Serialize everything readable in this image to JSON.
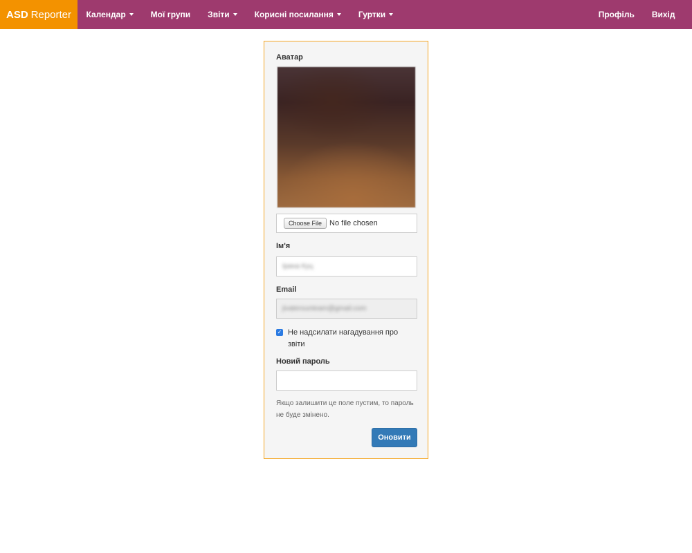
{
  "navbar": {
    "brand_bold": "ASD",
    "brand_regular": "Reporter",
    "left_items": [
      {
        "label": "Календар",
        "dropdown": true
      },
      {
        "label": "Мої групи",
        "dropdown": false
      },
      {
        "label": "Звіти",
        "dropdown": true
      },
      {
        "label": "Корисні посилання",
        "dropdown": true
      },
      {
        "label": "Гуртки",
        "dropdown": true
      }
    ],
    "right_items": [
      {
        "label": "Профіль"
      },
      {
        "label": "Вихід"
      }
    ],
    "colors": {
      "bar": "#9e3a6e",
      "brand": "#f39200"
    }
  },
  "form": {
    "avatar_label": "Аватар",
    "file_button": "Choose File",
    "file_status": "No file chosen",
    "name_label": "Ім'я",
    "name_value": "Ірина Куц",
    "email_label": "Email",
    "email_value": "jivaterounteam@gmail.com",
    "checkbox_checked": true,
    "checkbox_label": "Не надсилати нагадування про звіти",
    "password_label": "Новий пароль",
    "password_value": "",
    "help_text": "Якщо залишити це поле пустим, то пароль не буде змінено.",
    "submit_label": "Оновити",
    "colors": {
      "border": "#f5a623",
      "button": "#337ab7",
      "checkbox": "#2a7ae2"
    }
  }
}
